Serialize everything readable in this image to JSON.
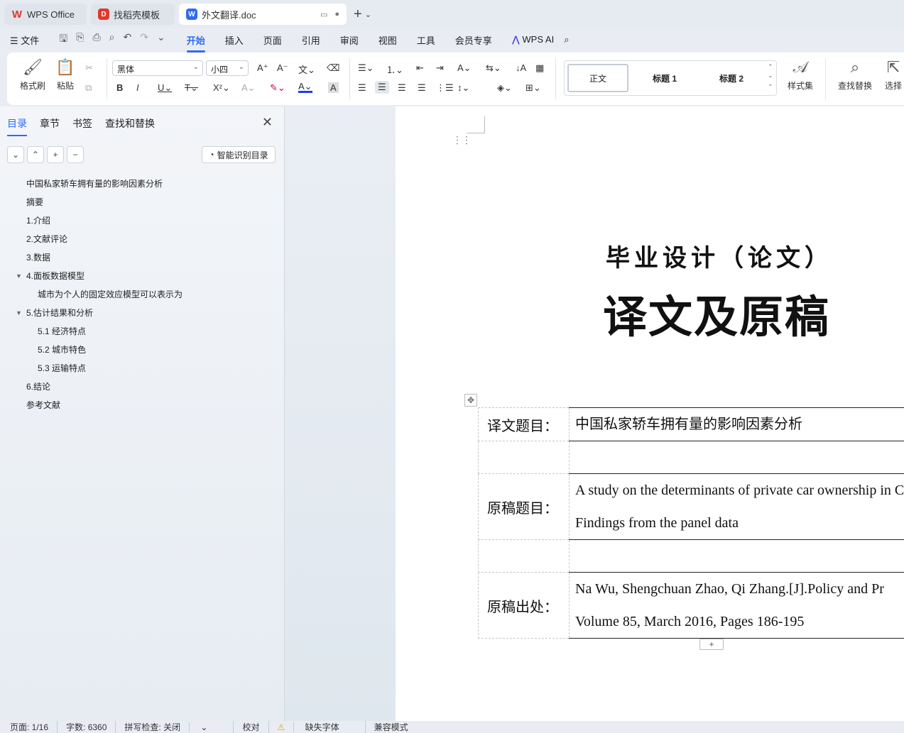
{
  "tabs": [
    {
      "label": "WPS Office",
      "icon": "wps-logo-icon"
    },
    {
      "label": "找稻壳模板",
      "icon": "docer-logo-icon"
    },
    {
      "label": "外文翻译.doc",
      "icon": "word-doc-icon",
      "active": true
    }
  ],
  "menubar": {
    "file": "文件",
    "items": [
      "开始",
      "插入",
      "页面",
      "引用",
      "审阅",
      "视图",
      "工具",
      "会员专享"
    ],
    "active": "开始",
    "ai": "WPS AI"
  },
  "ribbon": {
    "format_painter": "格式刷",
    "paste": "粘贴",
    "font_name": "黑体",
    "font_size": "小四",
    "styles": [
      "正文",
      "标题 1",
      "标题 2"
    ],
    "style_set": "样式集",
    "find_replace": "查找替换",
    "select": "选择"
  },
  "panel": {
    "tabs": [
      "目录",
      "章节",
      "书签",
      "查找和替换"
    ],
    "active_tab": "目录",
    "smart_button": "智能识别目录",
    "toc": [
      {
        "text": "中国私家轿车拥有量的影响因素分析",
        "level": 1
      },
      {
        "text": "摘要",
        "level": 1
      },
      {
        "text": "1.介绍",
        "level": 1
      },
      {
        "text": "2.文献评论",
        "level": 1
      },
      {
        "text": "3.数据",
        "level": 1
      },
      {
        "text": "4.面板数据模型",
        "level": 1,
        "expanded": true
      },
      {
        "text": "城市为个人的固定效应模型可以表示为",
        "level": 2
      },
      {
        "text": "5.估计结果和分析",
        "level": 1,
        "expanded": true
      },
      {
        "text": "5.1 经济特点",
        "level": 2
      },
      {
        "text": "5.2 城市特色",
        "level": 2
      },
      {
        "text": "5.3 运输特点",
        "level": 2
      },
      {
        "text": "6.结论",
        "level": 1
      },
      {
        "text": "参考文献",
        "level": 1
      }
    ]
  },
  "document": {
    "title1": "毕业设计（论文）",
    "title2": "译文及原稿",
    "table": {
      "translated_title_label": "译文题目：",
      "translated_title": "中国私家轿车拥有量的影响因素分析",
      "original_title_label": "原稿题目：",
      "original_title_line1": "A study on the determinants of private car ownership in C",
      "original_title_line2": "Findings from the panel data",
      "source_label": "原稿出处：",
      "source_line1": "Na Wu, Shengchuan Zhao, Qi Zhang.[J].Policy and Pr",
      "source_line2": "Volume 85, March 2016, Pages 186-195"
    }
  },
  "status": {
    "page": "页面: 1/16",
    "words": "字数: 6360",
    "spell": "拼写检查: 关闭",
    "proof": "校对",
    "missing_font": "缺失字体",
    "compat": "兼容模式"
  }
}
